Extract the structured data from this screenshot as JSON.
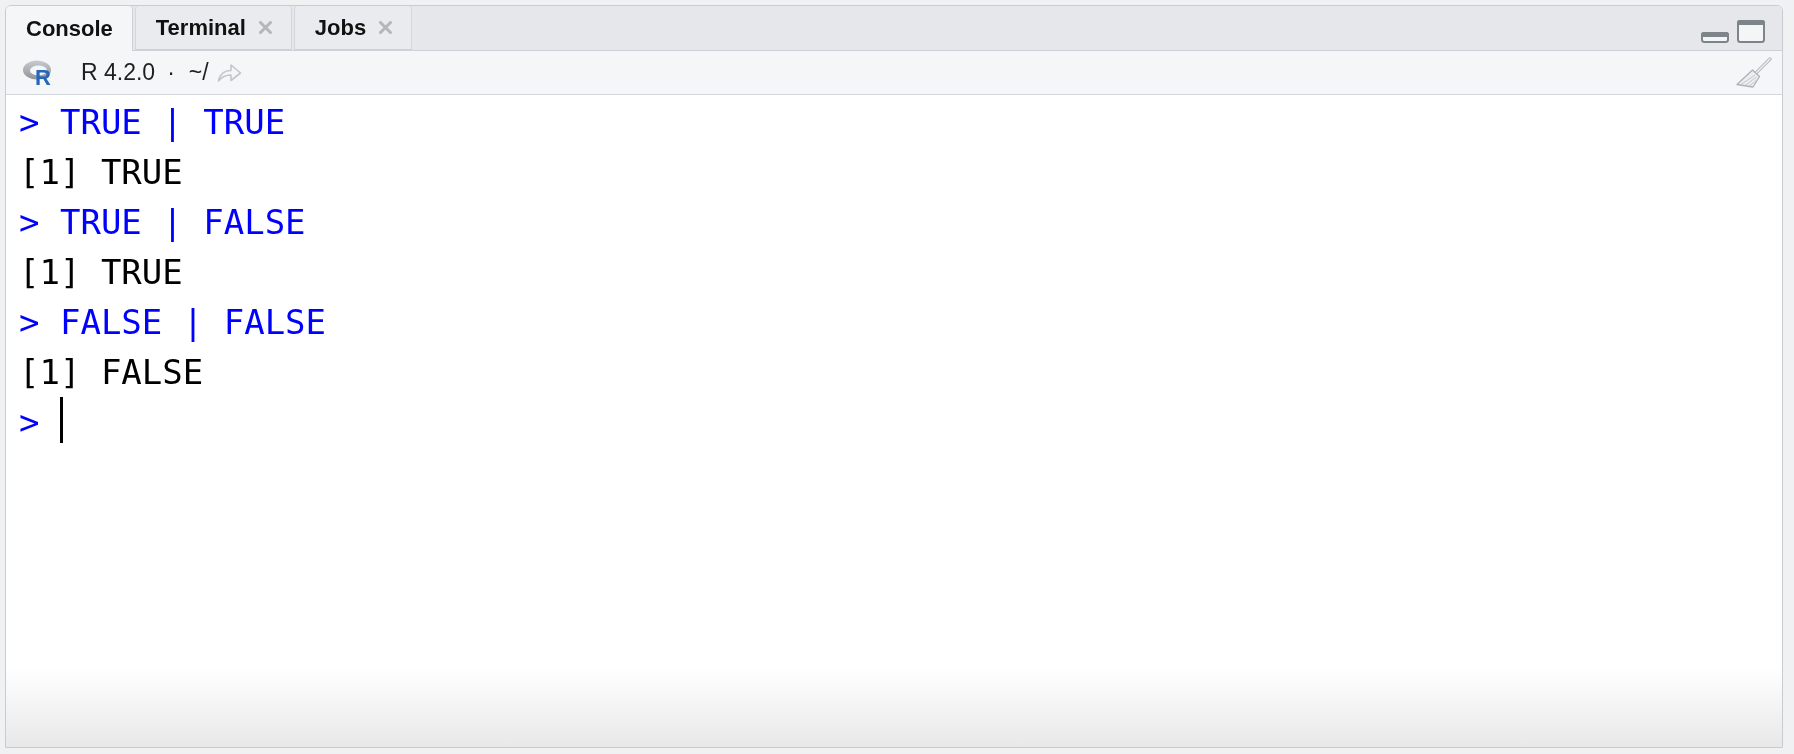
{
  "tabs": [
    {
      "label": "Console",
      "selected": true,
      "closable": false
    },
    {
      "label": "Terminal",
      "selected": false,
      "closable": true
    },
    {
      "label": "Jobs",
      "selected": false,
      "closable": true
    }
  ],
  "toolbar": {
    "logo_letter": "R",
    "version": "R 4.2.0",
    "separator": "·",
    "path": "~/"
  },
  "console": {
    "lines": [
      {
        "kind": "input",
        "prompt": ">",
        "code": "TRUE | TRUE"
      },
      {
        "kind": "output",
        "text": "[1] TRUE"
      },
      {
        "kind": "input",
        "prompt": ">",
        "code": "TRUE | FALSE"
      },
      {
        "kind": "output",
        "text": "[1] TRUE"
      },
      {
        "kind": "input",
        "prompt": ">",
        "code": "FALSE | FALSE"
      },
      {
        "kind": "output",
        "text": "[1] FALSE"
      },
      {
        "kind": "prompt",
        "prompt": ">",
        "focused": true
      }
    ]
  }
}
